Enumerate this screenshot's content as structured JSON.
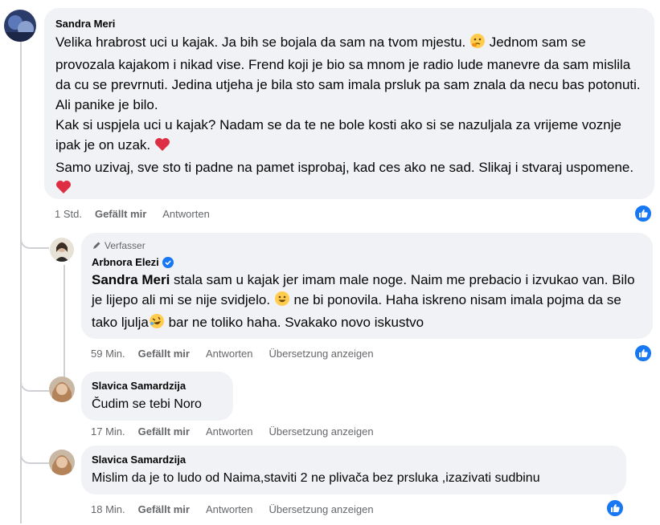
{
  "comments": [
    {
      "author": "Sandra Meri",
      "lines": [
        "Velika hrabrost uci u kajak. Ja bih se bojala da sam na tvom mjestu. ",
        " Jednom sam se provozala kajakom i nikad vise. Frend koji je bio sa mnom je radio lude manevre da sam mislila da cu se prevrnuti. Jedina utjeha je bila sto sam imala prsluk pa sam znala da necu bas potonuti. Ali panike je bilo.",
        "Kak si uspjela uci u kajak? Nadam se da te ne bole kosti ako si se nazuljala za vrijeme voznje ipak je on uzak. ",
        "Samo uzivaj, sve sto ti padne na pamet isprobaj, kad ces ako ne sad. Slikaj i stvaraj uspomene. "
      ],
      "time": "1 Std.",
      "like_label": "Gefällt mir",
      "reply_label": "Antworten"
    },
    {
      "author_badge": "Verfasser",
      "author": "Arbnora Elezi",
      "mention": "Sandra Meri",
      "text_a": " stala sam u kajak jer imam male noge. Naim me prebacio i izvukao van. Bilo je lijepo ali mi se nije svidjelo. ",
      "text_b": " ne bi ponovila. Haha iskreno nisam imala pojma da se tako ljulja",
      "text_c": " bar ne toliko haha. Svakako novo iskustvo",
      "time": "59 Min.",
      "like_label": "Gefällt mir",
      "reply_label": "Antworten",
      "translate_label": "Übersetzung anzeigen"
    },
    {
      "author": "Slavica Samardzija",
      "text": "Čudim se tebi Noro",
      "time": "17 Min.",
      "like_label": "Gefällt mir",
      "reply_label": "Antworten",
      "translate_label": "Übersetzung anzeigen"
    },
    {
      "author": "Slavica Samardzija",
      "text": "Mislim da je to ludo od Naima,staviti 2 ne plivača bez prsluka ,izazivati sudbinu",
      "time": "18 Min.",
      "like_label": "Gefällt mir",
      "reply_label": "Antworten",
      "translate_label": "Übersetzung anzeigen"
    }
  ],
  "colors": {
    "like_blue": "#1877f2",
    "bubble": "#f0f2f5",
    "meta": "#65676b"
  },
  "icons": [
    "thinking-emoji",
    "heart-emoji",
    "grinning-emoji",
    "rofl-emoji",
    "like-thumb-icon",
    "verified-badge-icon",
    "pen-icon"
  ]
}
